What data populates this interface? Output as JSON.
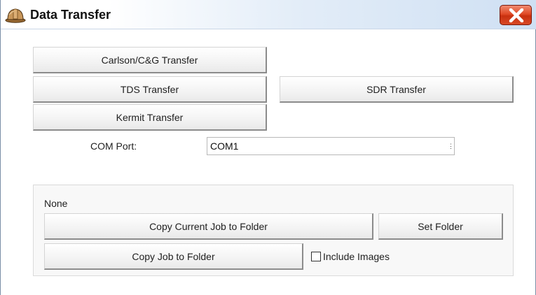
{
  "window": {
    "title": "Data Transfer",
    "icon": "hard-hat-icon",
    "close_icon": "close-icon"
  },
  "transfers": {
    "carlson": "Carlson/C&G Transfer",
    "tds": "TDS Transfer",
    "sdr": "SDR Transfer",
    "kermit": "Kermit Transfer"
  },
  "com_port": {
    "label": "COM Port:",
    "value": "COM1"
  },
  "folder": {
    "path": "None",
    "copy_current": "Copy Current Job to Folder",
    "set_folder": "Set Folder",
    "copy_job": "Copy Job to Folder",
    "include_images_label": "Include Images",
    "include_images_checked": false
  },
  "colors": {
    "close_button": "#d83a14",
    "hat_icon": "#b8864a"
  }
}
